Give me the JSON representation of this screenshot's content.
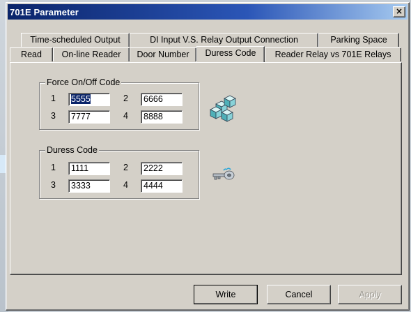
{
  "window": {
    "title": "701E Parameter",
    "close_glyph": "×"
  },
  "tabs_row1": [
    {
      "label": "Time-scheduled Output"
    },
    {
      "label": "DI Input  V.S. Relay Output Connection"
    },
    {
      "label": "Parking Space"
    }
  ],
  "tabs_row2": [
    {
      "label": "Read"
    },
    {
      "label": "On-line Reader"
    },
    {
      "label": "Door Number"
    },
    {
      "label": "Duress Code",
      "active": true
    },
    {
      "label": "Reader Relay vs 701E Relays"
    }
  ],
  "force_group": {
    "label": "Force On/Off Code",
    "fields": [
      {
        "index": "1",
        "value": "5555",
        "selected": true
      },
      {
        "index": "2",
        "value": "6666"
      },
      {
        "index": "3",
        "value": "7777"
      },
      {
        "index": "4",
        "value": "8888"
      }
    ],
    "icon": "cubes-icon"
  },
  "duress_group": {
    "label": "Duress Code",
    "fields": [
      {
        "index": "1",
        "value": "1111"
      },
      {
        "index": "2",
        "value": "2222"
      },
      {
        "index": "3",
        "value": "3333"
      },
      {
        "index": "4",
        "value": "4444"
      }
    ],
    "icon": "key-icon"
  },
  "buttons": {
    "write": "Write",
    "cancel": "Cancel",
    "apply": "Apply"
  }
}
